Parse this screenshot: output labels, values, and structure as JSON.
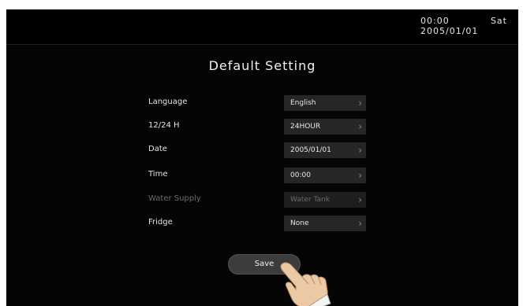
{
  "status": {
    "time": "00:00",
    "weekday": "Sat",
    "date": "2005/01/01"
  },
  "page": {
    "title": "Default Setting"
  },
  "settings": [
    {
      "label": "Language",
      "value": "English",
      "enabled": true
    },
    {
      "label": "12/24 H",
      "value": "24HOUR",
      "enabled": true
    },
    {
      "label": "Date",
      "value": "2005/01/01",
      "enabled": true
    },
    {
      "label": "Time",
      "value": "00:00",
      "enabled": true
    },
    {
      "label": "Water Supply",
      "value": "Water Tank",
      "enabled": false
    },
    {
      "label": "Fridge",
      "value": "None",
      "enabled": true
    }
  ],
  "actions": {
    "save_label": "Save"
  },
  "icons": {
    "row_arrow": "chevron-right-icon",
    "pointer": "pointing-hand-icon"
  },
  "colors": {
    "background": "#050505",
    "field": "#262626",
    "button": "#3c3c3c",
    "text": "#e8e8e8",
    "disabled_text": "#6b6b6b"
  }
}
